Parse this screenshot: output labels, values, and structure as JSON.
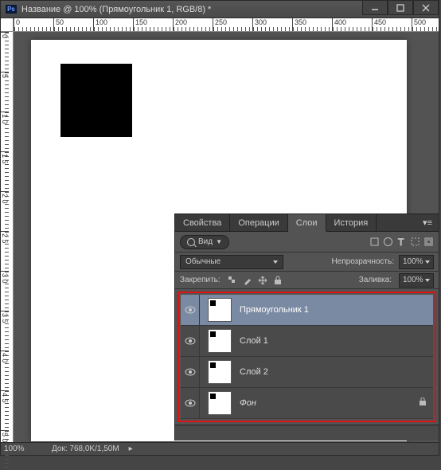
{
  "title": "Название @ 100% (Прямоугольник 1, RGB/8) *",
  "rulerH": [
    "0",
    "50",
    "100",
    "150",
    "200",
    "250",
    "300",
    "350",
    "400",
    "450",
    "500"
  ],
  "rulerV": [
    "0",
    "5",
    "1 0",
    "1 5",
    "2 0",
    "2 5",
    "3 0",
    "3 5",
    "4 0",
    "4 5",
    "5 0"
  ],
  "status": {
    "zoom": "100%",
    "doc": "Док: 768,0K/1,50M"
  },
  "panel": {
    "tabs": {
      "t0": "Свойства",
      "t1": "Операции",
      "t2": "Слои",
      "t3": "История"
    },
    "kind": "Вид",
    "blend": "Обычные",
    "opacity_label": "Непрозрачность:",
    "opacity": "100%",
    "fill_label": "Заливка:",
    "fill": "100%",
    "lock_label": "Закрепить:"
  },
  "layers": [
    {
      "name": "Прямоугольник 1"
    },
    {
      "name": "Слой 1"
    },
    {
      "name": "Слой 2"
    },
    {
      "name": "Фон"
    }
  ]
}
